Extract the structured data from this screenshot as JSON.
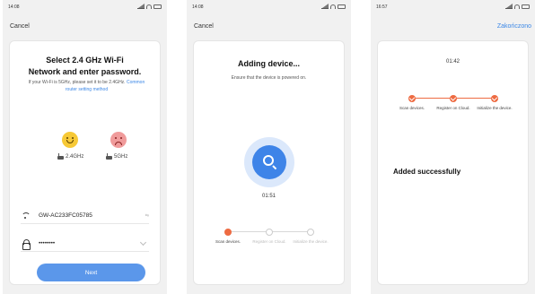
{
  "screen1": {
    "status_time": "14:08",
    "cancel": "Cancel",
    "title_line1": "Select 2.4 GHz Wi-Fi",
    "title_line2": "Network and enter password.",
    "subtitle": "If your Wi-Fi is 5GHz, please set it to be 2.4GHz.",
    "subtitle_link": "Common router setting method",
    "band_good": "2.4GHz",
    "band_bad": "5GHz",
    "ssid": "GW-AC233FC05785",
    "ssid_action": "⇆",
    "password_value": "••••••••",
    "next": "Next"
  },
  "screen2": {
    "status_time": "14:08",
    "cancel": "Cancel",
    "title": "Adding device...",
    "subtitle": "Ensure that the device is powered on.",
    "timer": "01:51",
    "steps": [
      "Scan devices.",
      "Register on Cloud.",
      "Initialize the device."
    ]
  },
  "screen3": {
    "status_time": "16:57",
    "done": "Zakończono",
    "timer": "01:42",
    "steps": [
      "Scan devices.",
      "Register on Cloud.",
      "Initialize the device."
    ],
    "result": "Added successfully"
  },
  "colors": {
    "accent": "#3e84e8",
    "progress": "#ee6b42"
  }
}
